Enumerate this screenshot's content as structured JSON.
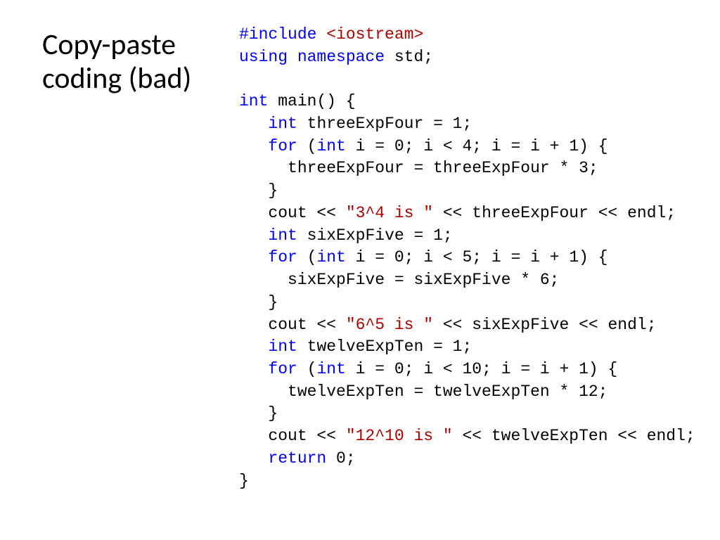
{
  "title": "Copy-paste coding (bad)",
  "code": {
    "t0": "#include ",
    "t1": "<iostream>",
    "t2": "using namespace",
    "t3": " std;",
    "t4": "int",
    "t5": " main() {",
    "t6": "   ",
    "t7": "int",
    "t8": " threeExpFour = 1;",
    "t9": "   ",
    "t10": "for",
    "t11": " (",
    "t12": "int",
    "t13": " i = 0; i < 4; i = i + 1) {",
    "t14": "     threeExpFour = threeExpFour * 3;",
    "t15": "   }",
    "t16": "   cout << ",
    "t17": "\"3^4 is \"",
    "t18": " << threeExpFour << endl;",
    "t19": "   ",
    "t20": "int",
    "t21": " sixExpFive = 1;",
    "t22": "   ",
    "t23": "for",
    "t24": " (",
    "t25": "int",
    "t26": " i = 0; i < 5; i = i + 1) {",
    "t27": "     sixExpFive = sixExpFive * 6;",
    "t28": "   }",
    "t29": "   cout << ",
    "t30": "\"6^5 is \"",
    "t31": " << sixExpFive << endl;",
    "t32": "   ",
    "t33": "int",
    "t34": " twelveExpTen = 1;",
    "t35": "   ",
    "t36": "for",
    "t37": " (",
    "t38": "int",
    "t39": " i = 0; i < 10; i = i + 1) {",
    "t40": "     twelveExpTen = twelveExpTen * 12;",
    "t41": "   }",
    "t42": "   cout << ",
    "t43": "\"12^10 is \"",
    "t44": " << twelveExpTen << endl;",
    "t45": "   ",
    "t46": "return",
    "t47": " 0;",
    "t48": "}"
  }
}
